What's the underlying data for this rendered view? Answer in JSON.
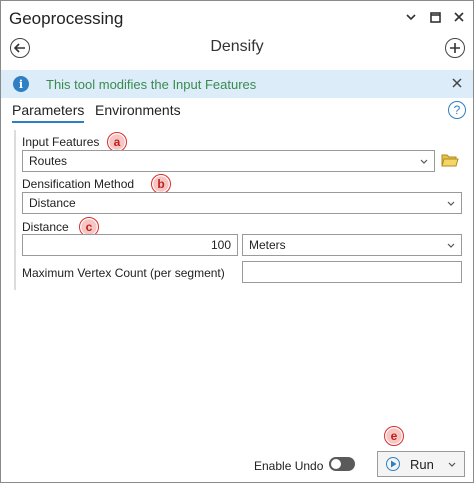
{
  "pane": {
    "title": "Geoprocessing",
    "icons": [
      "chevron-down-icon",
      "restore-icon",
      "close-icon"
    ]
  },
  "tool": {
    "title": "Densify"
  },
  "info": {
    "message": "This tool modifies the Input Features"
  },
  "tabs": [
    {
      "label": "Parameters",
      "active": true
    },
    {
      "label": "Environments",
      "active": false
    }
  ],
  "params": {
    "input_features": {
      "label": "Input Features",
      "value": "Routes",
      "badge": "a"
    },
    "densification_method": {
      "label": "Densification Method",
      "value": "Distance",
      "badge": "b"
    },
    "distance": {
      "label": "Distance",
      "value": "100",
      "unit": "Meters",
      "badge": "c"
    },
    "max_vertex": {
      "label": "Maximum Vertex Count (per segment)",
      "value": ""
    }
  },
  "footer": {
    "enable_undo_label": "Enable Undo",
    "run_label": "Run",
    "run_badge": "e"
  },
  "colors": {
    "accent": "#2f7fc4",
    "info_bg": "#dcedf9",
    "info_text": "#3a8a4f",
    "badge_border": "#d9302c"
  }
}
